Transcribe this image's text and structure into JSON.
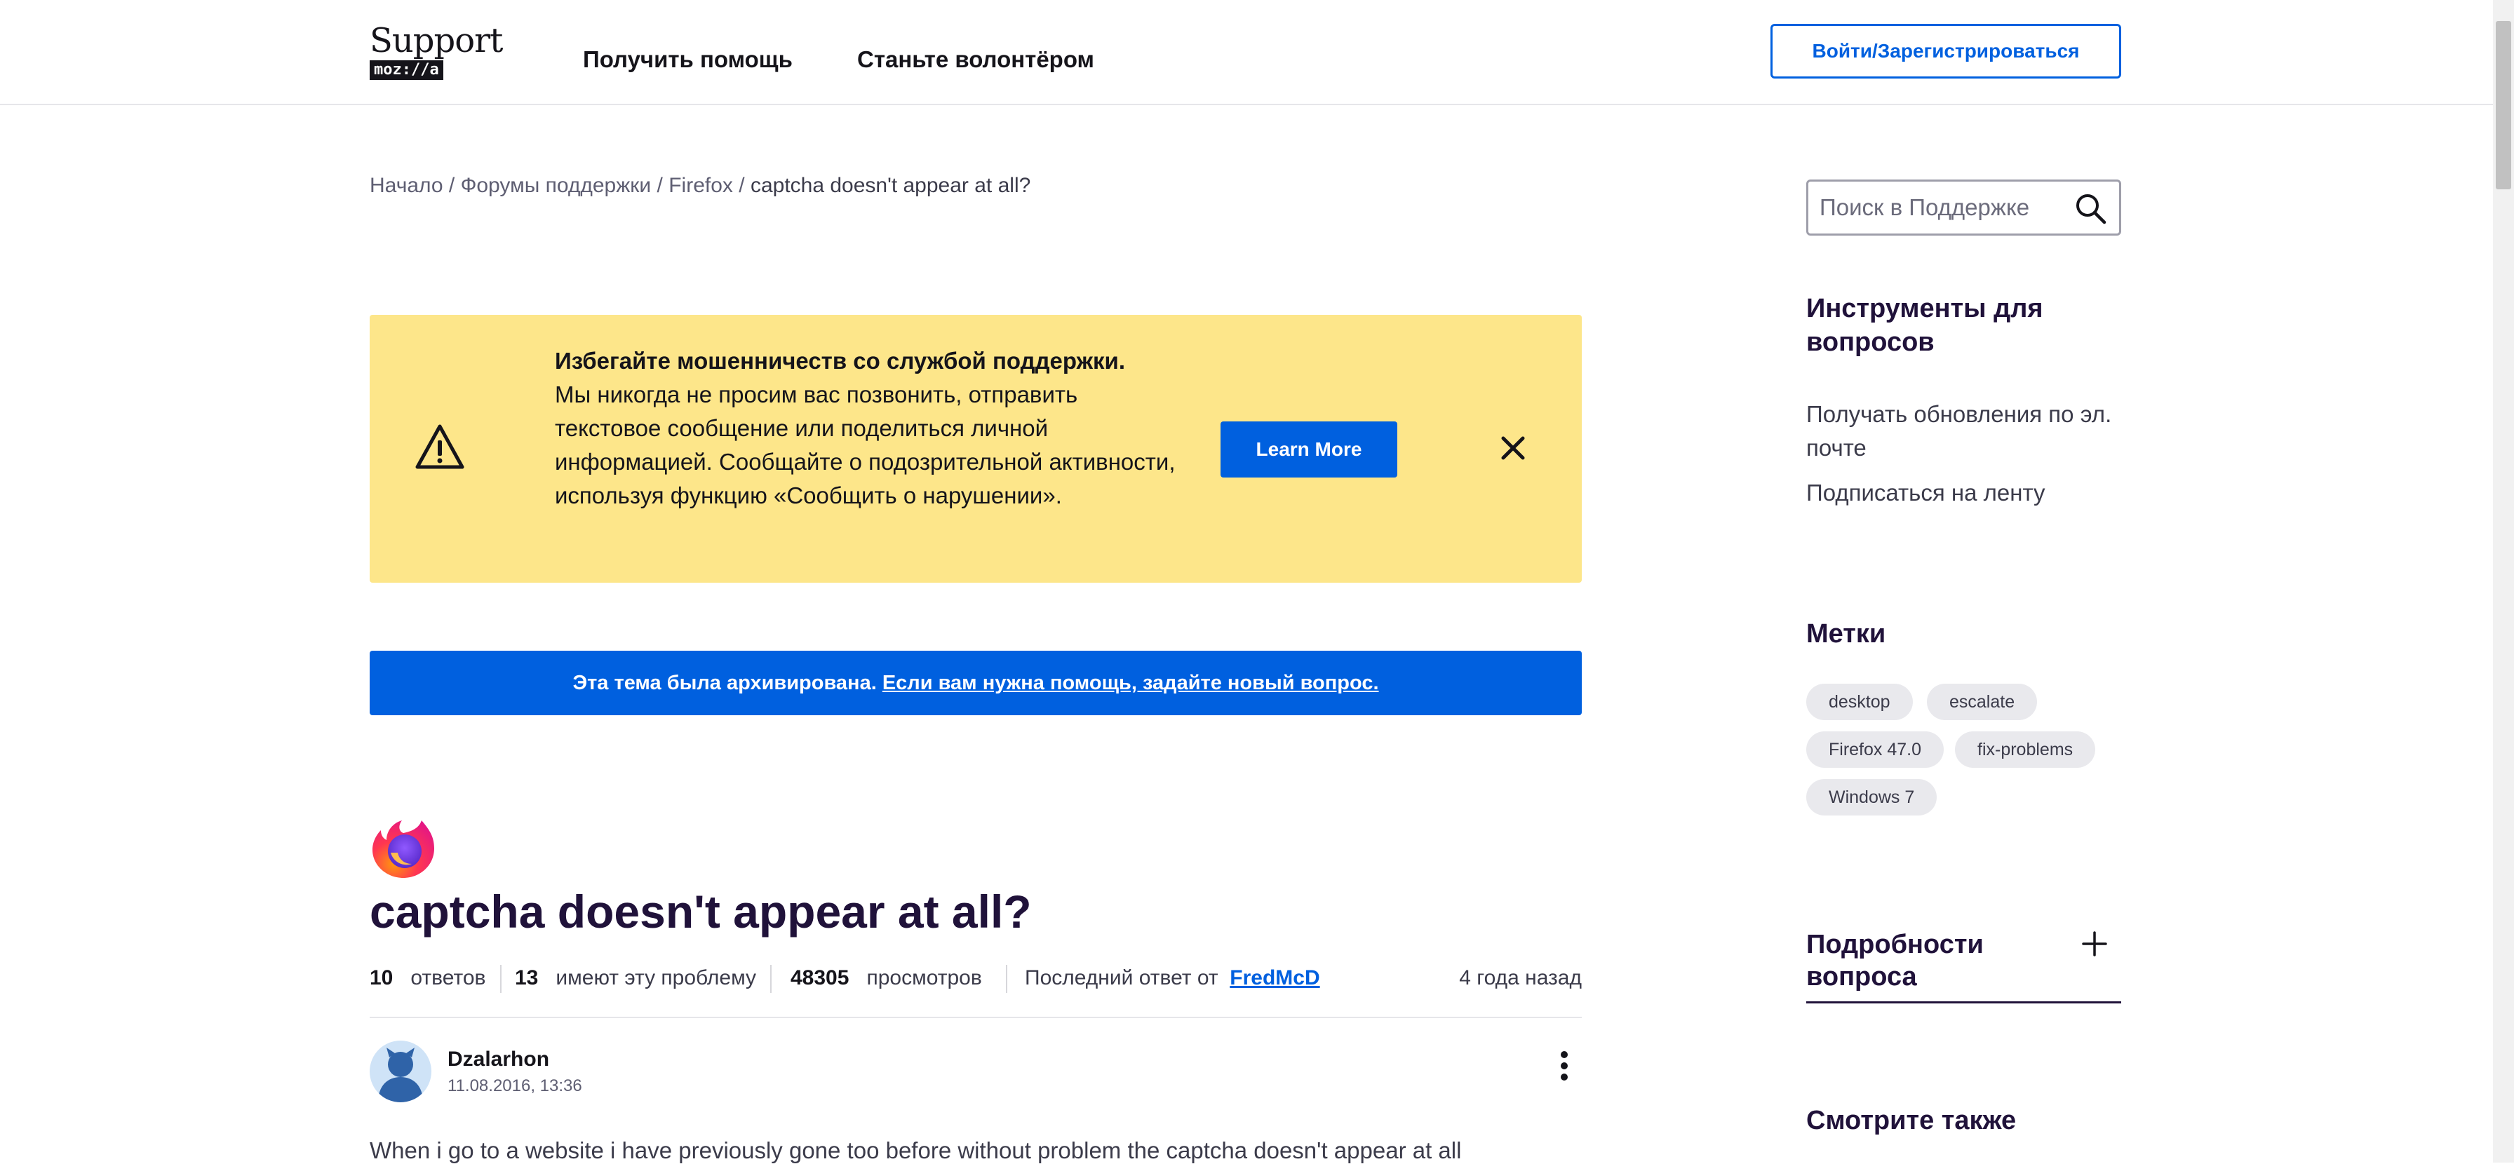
{
  "header": {
    "logo_text": "Support",
    "logo_sub": "moz://a",
    "nav": [
      "Получить помощь",
      "Станьте волонтёром"
    ],
    "signin_label": "Войти/Зарегистрироваться"
  },
  "breadcrumb": {
    "items": [
      "Начало",
      "Форумы поддержки",
      "Firefox"
    ],
    "current": "captcha doesn't appear at all?",
    "separator": "/"
  },
  "warning": {
    "title": "Избегайте мошенничеств со службой поддержки.",
    "body": "Мы никогда не просим вас позвонить, отправить текстовое сообщение или поделиться личной информацией. Сообщайте о подозрительной активности, используя функцию «Сообщить о нарушении».",
    "button_label": "Learn More"
  },
  "archived": {
    "text": "Эта тема была архивирована.",
    "link": "Если вам нужна помощь, задайте новый вопрос."
  },
  "question": {
    "title": "captcha doesn't appear at all?",
    "replies_count": "10",
    "replies_label": "ответов",
    "has_problem_count": "13",
    "has_problem_label": "имеют эту проблему",
    "views_count": "48305",
    "views_label": "просмотров",
    "last_reply_label": "Последний ответ от",
    "last_reply_user": "FredMcD",
    "time_ago": "4 года назад"
  },
  "post": {
    "author": "Dzalarhon",
    "date": "11.08.2016, 13:36",
    "body": "When i go to a website i have previously gone too before without problem the captcha doesn't appear at all"
  },
  "sidebar": {
    "search_placeholder": "Поиск в Поддержке",
    "tools_heading": "Инструменты для вопросов",
    "email_updates": "Получать обновления по эл. почте",
    "subscribe_feed": "Подписаться на ленту",
    "tags_heading": "Метки",
    "tags": [
      "desktop",
      "escalate",
      "Firefox 47.0",
      "fix-problems",
      "Windows 7"
    ],
    "details_heading": "Подробности вопроса",
    "see_also_heading": "Смотрите также"
  },
  "colors": {
    "accent": "#0060df",
    "warning_bg": "#fde68a",
    "heading": "#20123a",
    "text": "#3b3b4a",
    "tag_bg": "#e9e9ed"
  }
}
